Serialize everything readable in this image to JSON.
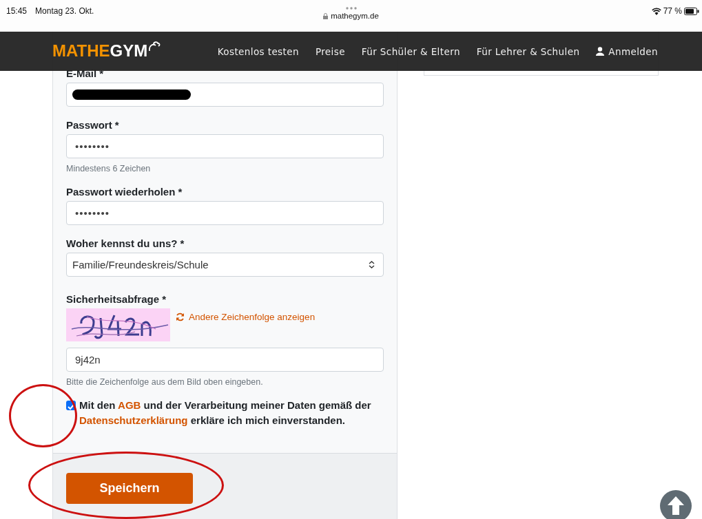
{
  "status_bar": {
    "time": "15:45",
    "date": "Montag 23. Okt.",
    "url": "mathegym.de",
    "battery": "77 %"
  },
  "navbar": {
    "logo": {
      "part_1": "MATHE",
      "part_2": "GYM"
    },
    "links": [
      {
        "label": "Kostenlos testen"
      },
      {
        "label": "Preise"
      },
      {
        "label": "Für Schüler & Eltern"
      },
      {
        "label": "Für Lehrer & Schulen"
      }
    ],
    "login": "Anmelden"
  },
  "form": {
    "fields": [
      {
        "kind": "text",
        "label": "E-Mail *",
        "redacted": true
      },
      {
        "kind": "password",
        "label": "Passwort *",
        "value": "••••••••",
        "hint": "Mindestens 6 Zeichen"
      },
      {
        "kind": "password",
        "label": "Passwort wiederholen *",
        "value": "••••••••"
      },
      {
        "kind": "select",
        "label": "Woher kennst du uns? *",
        "value": "Familie/Freundeskreis/Schule"
      },
      {
        "kind": "captcha",
        "label": "Sicherheitsabfrage *",
        "refresh_link": "Andere Zeichenfolge anzeigen",
        "value": "9j42n",
        "hint": "Bitte die Zeichenfolge aus dem Bild oben eingeben."
      }
    ],
    "consent": {
      "checked": true,
      "parts": [
        {
          "text": "Mit den ",
          "link": false
        },
        {
          "text": "AGB",
          "link": true
        },
        {
          "text": " und der Verarbeitung meiner Daten gemäß der ",
          "link": false
        },
        {
          "text": "Datenschutzerklärung",
          "link": true
        },
        {
          "text": " erkläre ich mich einverstanden.",
          "link": false
        }
      ]
    },
    "submit": "Speichern"
  }
}
